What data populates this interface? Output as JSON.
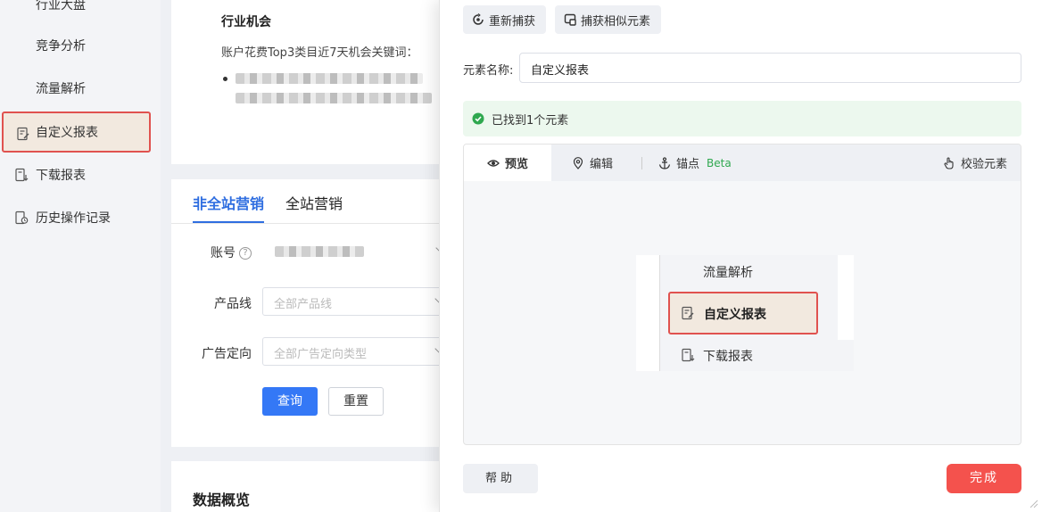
{
  "sidebar": {
    "items": [
      {
        "label": "行业大盘"
      },
      {
        "label": "竞争分析"
      },
      {
        "label": "流量解析"
      },
      {
        "label": "自定义报表"
      },
      {
        "label": "下载报表"
      },
      {
        "label": "历史操作记录"
      }
    ]
  },
  "main": {
    "opportunity": {
      "title": "行业机会",
      "desc": "账户花费Top3类目近7天机会关键词："
    },
    "tabs": [
      {
        "label": "非全站营销"
      },
      {
        "label": "全站营销"
      }
    ],
    "form": {
      "account_label": "账号",
      "product_label": "产品线",
      "product_placeholder": "全部产品线",
      "ad_label": "广告定向",
      "ad_placeholder": "全部广告定向类型",
      "query_button": "查询",
      "reset_button": "重置"
    },
    "overview_title": "数据概览"
  },
  "panel": {
    "recapture_button": "重新捕获",
    "capture_similar_button": "捕获相似元素",
    "element_name_label": "元素名称:",
    "element_name_value": "自定义报表",
    "found_message": "已找到1个元素",
    "tabs": {
      "preview": "预览",
      "edit": "编辑",
      "anchor": "锚点",
      "anchor_badge": "Beta",
      "verify": "校验元素"
    },
    "preview_items": {
      "above": "流量解析",
      "active": "自定义报表",
      "below": "下载报表"
    },
    "help_button": "帮助",
    "done_button": "完成"
  },
  "colors": {
    "accent": "#3478f6",
    "highlight_border": "#e0524f",
    "highlight_bg": "#f2e9df",
    "success": "#2fa84f",
    "done": "#f4524d"
  }
}
